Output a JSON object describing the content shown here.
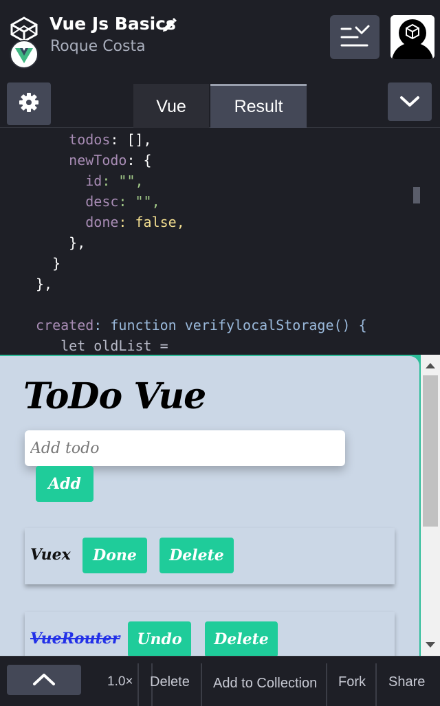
{
  "header": {
    "title": "Vue Js Basics",
    "author": "Roque Costa"
  },
  "tabs": [
    {
      "label": "Vue",
      "active": false
    },
    {
      "label": "Result",
      "active": true
    }
  ],
  "editor": {
    "lines": [
      {
        "indent": "    ",
        "key": "todos",
        "rest": ": [],"
      },
      {
        "indent": "    ",
        "key": "newTodo",
        "rest": ": {"
      },
      {
        "indent": "      ",
        "key": "id",
        "rest": ": \"\","
      },
      {
        "indent": "      ",
        "key": "desc",
        "rest": ": \"\","
      },
      {
        "indent": "      ",
        "key": "done",
        "rest": ": false,"
      },
      {
        "indent": "    ",
        "key": "",
        "rest": "},"
      },
      {
        "indent": "  ",
        "key": "",
        "rest": "}"
      },
      {
        "indent": "",
        "key": "",
        "rest": "},"
      },
      {
        "indent": "",
        "key": "",
        "rest": ""
      },
      {
        "indent": "",
        "key": "created",
        "rest": ": function verifylocalStorage() {"
      },
      {
        "indent": "   ",
        "key": "",
        "rest": "let oldList ="
      }
    ]
  },
  "result": {
    "app_title": "ToDo Vue",
    "input_placeholder": "Add todo",
    "input_value": "",
    "add_label": "Add",
    "todos": [
      {
        "text": "Vuex",
        "done": false,
        "toggle_label": "Done",
        "delete_label": "Delete"
      },
      {
        "text": "VueRouter",
        "done": true,
        "toggle_label": "Undo",
        "delete_label": "Delete"
      }
    ]
  },
  "footer": {
    "zoom": "1.0×",
    "delete_label": "Delete",
    "collection_label": "Add to Collection",
    "fork_label": "Fork",
    "share_label": "Share"
  },
  "icons": {
    "logo": "codepen-cube-icon",
    "vue": "vue-logo-icon",
    "edit": "pencil-icon",
    "layout": "view-switcher-icon",
    "settings": "gear-icon",
    "collapse": "chevron-down-icon",
    "expand": "chevron-up-icon"
  },
  "colors": {
    "accent_green": "#1fcc9a",
    "result_bg": "#cbd7e6",
    "ui_button": "#444857",
    "ui_bg": "#1e1f26"
  }
}
